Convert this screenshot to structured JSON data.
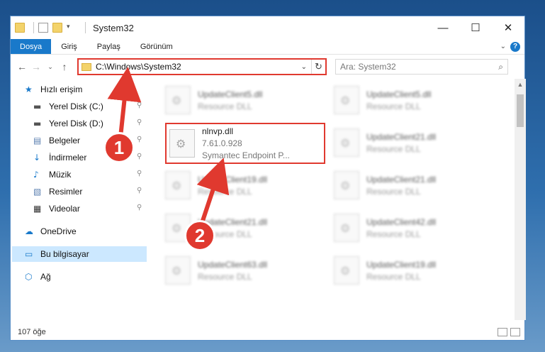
{
  "window": {
    "title": "System32",
    "controls": {
      "minimize": "—",
      "maximize": "☐",
      "close": "✕"
    }
  },
  "ribbon": {
    "tabs": [
      "Dosya",
      "Giriş",
      "Paylaş",
      "Görünüm"
    ]
  },
  "nav": {
    "address": "C:\\Windows\\System32",
    "search_placeholder": "Ara: System32"
  },
  "sidebar": {
    "items": [
      {
        "label": "Hızlı erişim",
        "icon": "star-icon",
        "pinned": false
      },
      {
        "label": "Yerel Disk (C:)",
        "icon": "drive-icon",
        "pinned": true
      },
      {
        "label": "Yerel Disk (D:)",
        "icon": "drive-icon",
        "pinned": true
      },
      {
        "label": "Belgeler",
        "icon": "documents-icon",
        "pinned": true
      },
      {
        "label": "İndirmeler",
        "icon": "downloads-icon",
        "pinned": true
      },
      {
        "label": "Müzik",
        "icon": "music-icon",
        "pinned": true
      },
      {
        "label": "Resimler",
        "icon": "pictures-icon",
        "pinned": true
      },
      {
        "label": "Videolar",
        "icon": "videos-icon",
        "pinned": true
      },
      {
        "label": "OneDrive",
        "icon": "cloud-icon",
        "pinned": false
      },
      {
        "label": "Bu bilgisayar",
        "icon": "computer-icon",
        "pinned": false,
        "selected": true
      },
      {
        "label": "Ağ",
        "icon": "network-icon",
        "pinned": false
      }
    ]
  },
  "files": [
    {
      "name": "UpdateClient5.dll",
      "desc": "Resource DLL",
      "blurred": true
    },
    {
      "name": "UpdateClient5.dll",
      "desc": "Resource DLL",
      "blurred": true
    },
    {
      "name": "nlnvp.dll",
      "version": "7.61.0.928",
      "desc": "Symantec Endpoint P...",
      "blurred": false
    },
    {
      "name": "UpdateClient21.dll",
      "desc": "Resource DLL",
      "blurred": true
    },
    {
      "name": "UpdateClient19.dll",
      "desc": "Resource DLL",
      "blurred": true
    },
    {
      "name": "UpdateClient21.dll",
      "desc": "Resource DLL",
      "blurred": true
    },
    {
      "name": "UpdateClient21.dll",
      "desc": "Resource DLL",
      "blurred": true
    },
    {
      "name": "UpdateClient42.dll",
      "desc": "Resource DLL",
      "blurred": true
    },
    {
      "name": "UpdateClient63.dll",
      "desc": "Resource DLL",
      "blurred": true
    },
    {
      "name": "UpdateClient19.dll",
      "desc": "Resource DLL",
      "blurred": true
    }
  ],
  "status": {
    "item_count": "107 öğe"
  },
  "annotations": [
    {
      "number": "1",
      "color": "#e0392f"
    },
    {
      "number": "2",
      "color": "#e0392f"
    }
  ]
}
